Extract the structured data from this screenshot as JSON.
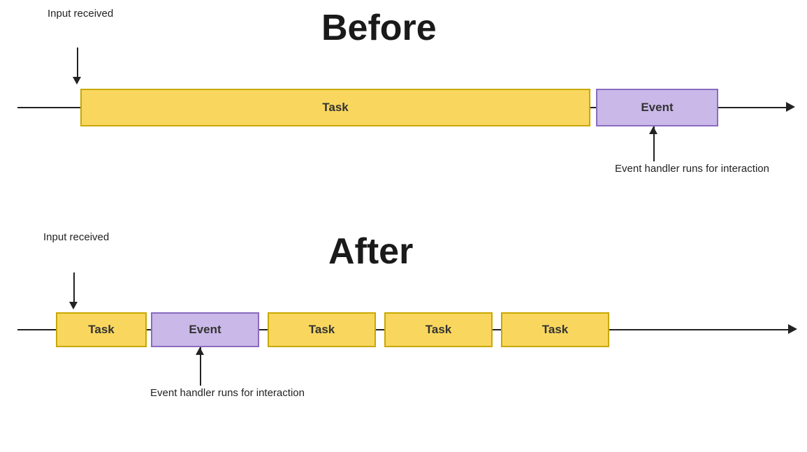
{
  "before": {
    "title": "Before",
    "input_received_label": "Input\nreceived",
    "event_handler_label": "Event handler\nruns for interaction",
    "task_label": "Task",
    "event_label": "Event"
  },
  "after": {
    "title": "After",
    "input_received_label": "Input\nreceived",
    "event_handler_label": "Event handler\nruns for interaction",
    "task_label": "Task",
    "event_label": "Event"
  },
  "colors": {
    "task_bg": "#f9d75e",
    "task_border": "#c8a800",
    "event_bg": "#c9b8e8",
    "event_border": "#8a6bbf",
    "line": "#222222"
  }
}
